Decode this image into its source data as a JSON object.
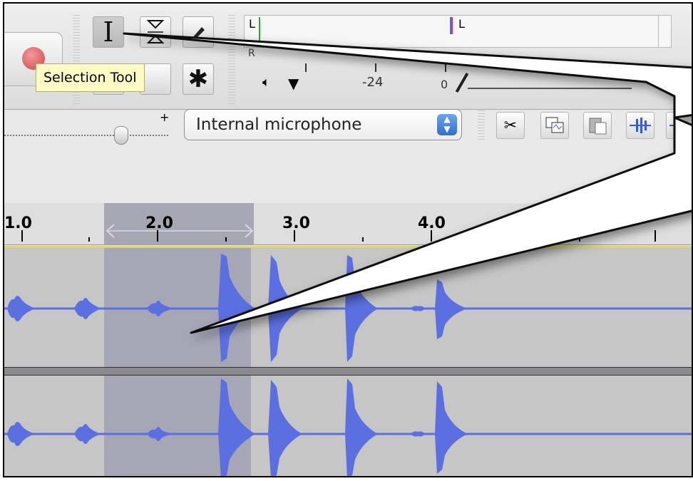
{
  "tooltip": {
    "text": "Selection Tool"
  },
  "meter": {
    "left_label": "L",
    "right_label": "R",
    "db_minus24": "-24",
    "db_zero": "0"
  },
  "input_device": {
    "selected": "Internal microphone"
  },
  "slider": {
    "plus_label": "+"
  },
  "timeline": {
    "labels": [
      "1.0",
      "2.0",
      "3.0",
      "4.0"
    ]
  },
  "icons": [
    "record-icon",
    "selection-tool-icon",
    "envelope-tool-icon",
    "draw-tool-icon",
    "zoom-tool-icon",
    "multi-tool-icon",
    "speaker-icon",
    "cut-icon",
    "copy-icon",
    "paste-icon",
    "trim-icon",
    "silence-icon"
  ],
  "colors": {
    "waveform": "#5b6fe0",
    "selection": "#a6a6b7",
    "track_bg": "#c6c6c6",
    "tooltip_bg": "#fdfac4"
  }
}
